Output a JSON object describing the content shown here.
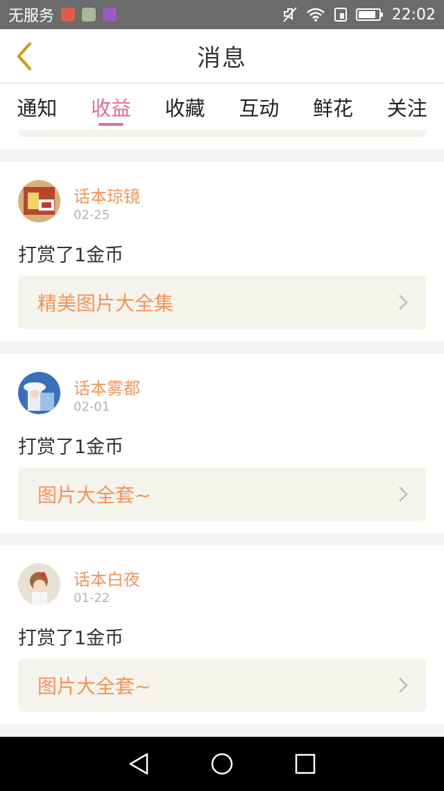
{
  "status_bar": {
    "carrier": "无服务",
    "time": "22:02",
    "icons": [
      "mail-app-icon",
      "qr-app-icon",
      "gallery-app-icon",
      "mute-icon",
      "wifi-icon",
      "sim-icon",
      "battery-icon"
    ]
  },
  "header": {
    "title": "消息",
    "back_icon": "chevron-left-icon"
  },
  "tabs": [
    {
      "label": "通知",
      "active": false
    },
    {
      "label": "收益",
      "active": true
    },
    {
      "label": "收藏",
      "active": false
    },
    {
      "label": "互动",
      "active": false
    },
    {
      "label": "鲜花",
      "active": false
    },
    {
      "label": "关注",
      "active": false
    }
  ],
  "messages": [
    {
      "name": "话本琼镜",
      "date": "02-25",
      "action": "打赏了1金币",
      "link": "精美图片大全集"
    },
    {
      "name": "话本雾都",
      "date": "02-01",
      "action": "打赏了1金币",
      "link": "图片大全套~"
    },
    {
      "name": "话本白夜",
      "date": "01-22",
      "action": "打赏了1金币",
      "link": "图片大全套~"
    }
  ],
  "colors": {
    "accent_pink": "#e56a9a",
    "name_orange": "#f0955a",
    "link_bg": "#f4f3ec"
  },
  "nav_bar": [
    "back-triangle-icon",
    "home-circle-icon",
    "recents-square-icon"
  ]
}
